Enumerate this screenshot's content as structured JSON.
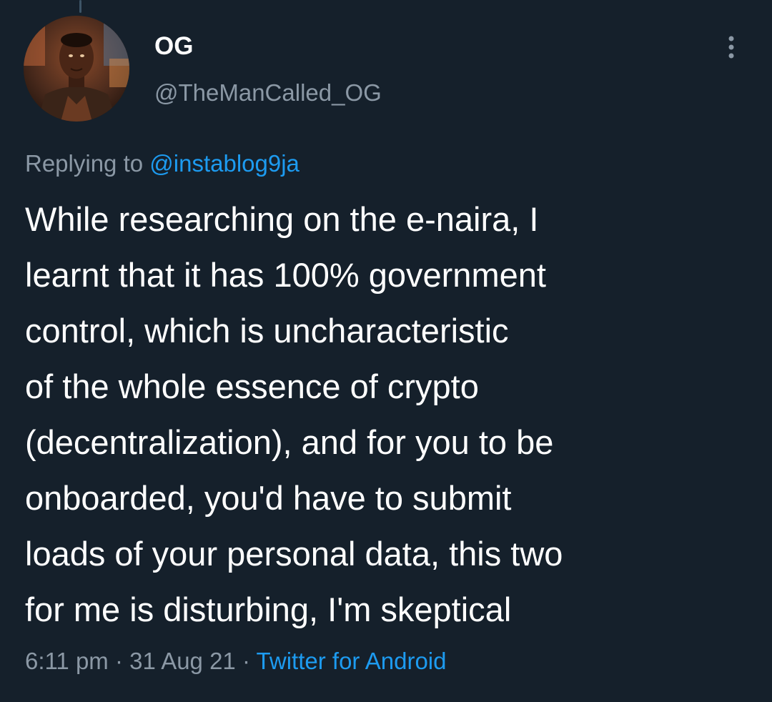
{
  "tweet": {
    "author": {
      "display_name": "OG",
      "handle": "@TheManCalled_OG"
    },
    "more_icon": "more-vertical-icon",
    "reply": {
      "prefix": "Replying to",
      "mention": "@instablog9ja"
    },
    "text_lines": [
      "While researching on the e-naira, I",
      "learnt that it has 100% government",
      "control, which is uncharacteristic",
      "of the whole essence of crypto",
      "(decentralization), and for you to be",
      "onboarded, you'd have to submit",
      "loads of your personal data, this two",
      "for me is disturbing, I'm skeptical"
    ],
    "meta": {
      "time": "6:11 pm",
      "separator": "·",
      "date": "31 Aug 21",
      "source": "Twitter for Android"
    }
  },
  "colors": {
    "background": "#15202b",
    "primary_text": "#ffffff",
    "secondary_text": "#8b98a5",
    "accent": "#1d9bf0"
  }
}
